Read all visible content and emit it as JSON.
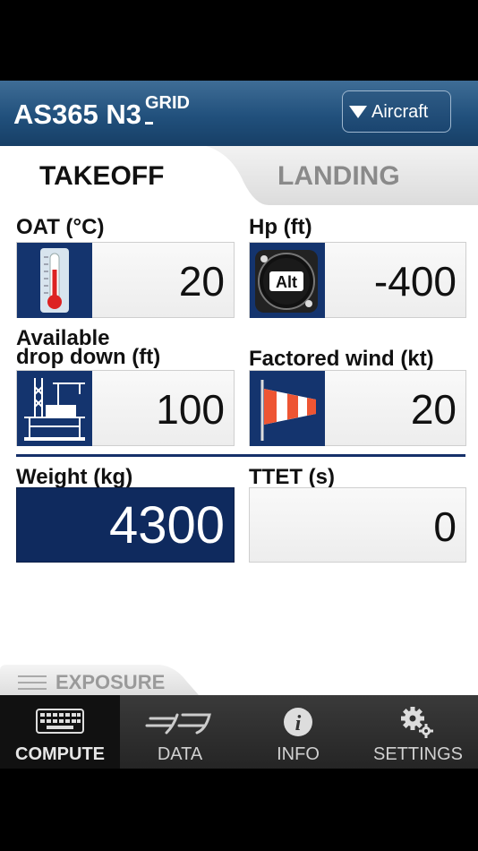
{
  "header": {
    "title": "AS365 N3",
    "title_superscript": "GRID",
    "aircraft_button": "Aircraft"
  },
  "tabs": {
    "takeoff": "TAKEOFF",
    "landing": "LANDING"
  },
  "fields": {
    "oat": {
      "label": "OAT (°C)",
      "value": "20",
      "icon": "thermometer-icon"
    },
    "hp": {
      "label": "Hp (ft)",
      "value": "-400",
      "icon": "altimeter-icon"
    },
    "drop": {
      "label_line1": "Available",
      "label_line2": "drop down (ft)",
      "value": "100",
      "icon": "oil-rig-icon"
    },
    "wind": {
      "label": "Factored wind (kt)",
      "value": "20",
      "icon": "windsock-icon"
    },
    "weight": {
      "label": "Weight (kg)",
      "value": "4300"
    },
    "ttet": {
      "label": "TTET (s)",
      "value": "0"
    }
  },
  "exposure": {
    "label": "EXPOSURE"
  },
  "tabbar": [
    {
      "label": "COMPUTE",
      "icon": "keyboard-icon",
      "active": true
    },
    {
      "label": "DATA",
      "icon": "data-icon",
      "active": false
    },
    {
      "label": "INFO",
      "icon": "info-icon",
      "active": false
    },
    {
      "label": "SETTINGS",
      "icon": "gear-icon",
      "active": false
    }
  ],
  "colors": {
    "header": "#21507c",
    "field_icon_bg": "#14346e",
    "selected_field": "#0f2a5e"
  }
}
